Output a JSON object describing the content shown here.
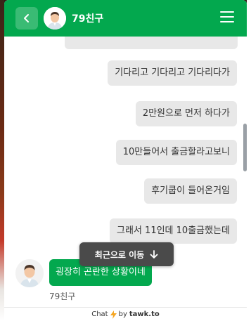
{
  "header": {
    "name": "79친구",
    "colors": {
      "accent": "#03a84e"
    },
    "icons": {
      "back": "chevron-left-icon",
      "menu": "hamburger-menu-icon"
    }
  },
  "messages": {
    "outgoing": [
      {
        "text": "기다리고 기다리고 기다리다가"
      },
      {
        "text": "2만원으로 먼저 하다가"
      },
      {
        "text": "10만들어서 출금할라고보니"
      },
      {
        "text": "후기쿱이 들어온거임"
      },
      {
        "text": "그래서 11인데 10출금했는데"
      }
    ],
    "incoming": {
      "text": "굉장히 곤란한 상황이네",
      "sender": "79친구"
    }
  },
  "recent_button": {
    "label": "최근으로 이동",
    "icon": "arrow-down-icon"
  },
  "footer": {
    "prefix": "Chat",
    "by": "by",
    "brand": "tawk.to",
    "icon": "lightning-icon"
  }
}
